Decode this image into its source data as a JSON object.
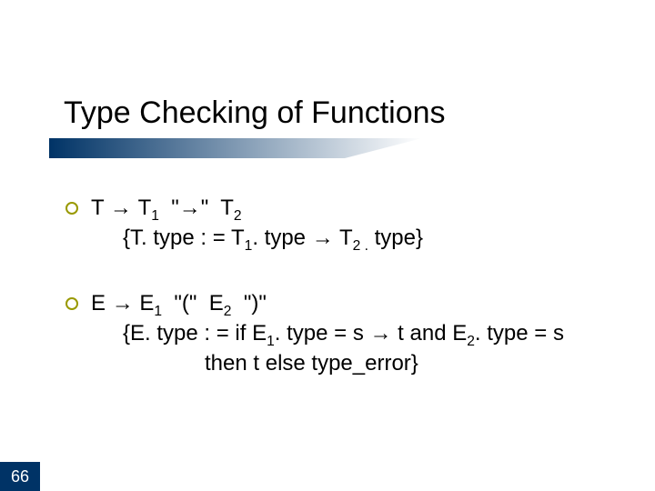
{
  "title": "Type Checking of Functions",
  "page_number": "66",
  "rules": {
    "t": {
      "lhs": {
        "T": "T",
        "T1": "T",
        "T1_sub": "1",
        "arrow_lit": "\"→\"",
        "T2": "T",
        "T2_sub": "2"
      },
      "sem": {
        "pre": "{T. type : = T",
        "T1_sub": "1",
        "mid": ". type  ",
        "arrow": "→",
        "after": "  T",
        "T2_sub": "2 .",
        "tail": " type}"
      }
    },
    "e": {
      "lhs": {
        "E": "E",
        "E1": "E",
        "E1_sub": "1",
        "open": "\"(\"",
        "E2": "E",
        "E2_sub": "2",
        "close": "\")\""
      },
      "sem1": {
        "pre": "{E. type : = if E",
        "E1_sub": "1",
        "mid": ". type = s ",
        "arrow": "→",
        "after": " t and E",
        "E2_sub": "2",
        "tail": ". type = s"
      },
      "sem2": "then t else type_error}"
    }
  }
}
